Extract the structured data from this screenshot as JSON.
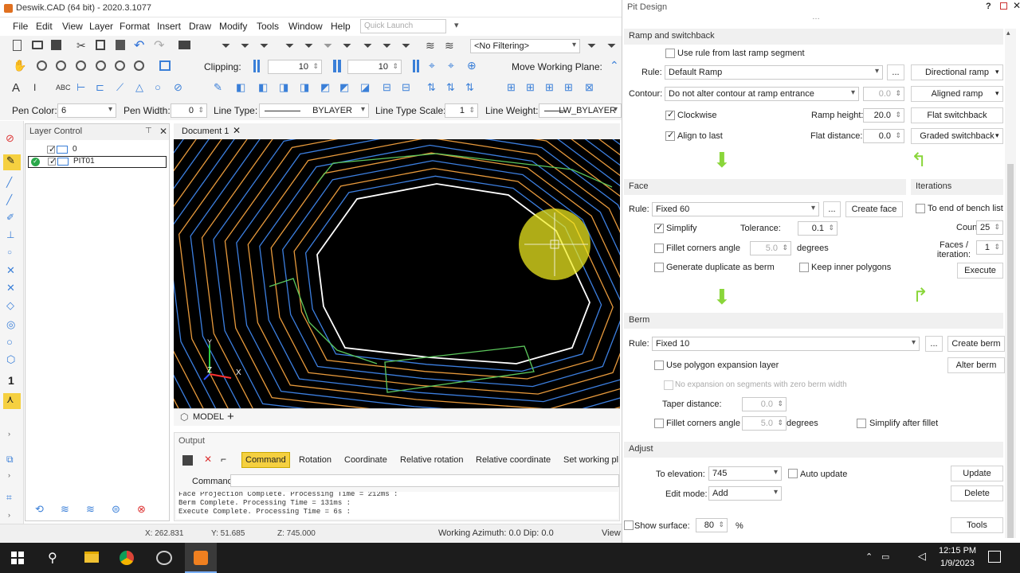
{
  "app": {
    "title": "Deswik.CAD (64 bit) - 2020.3.1077",
    "quick_launch_placeholder": "Quick Launch"
  },
  "menu": [
    "File",
    "Edit",
    "View",
    "Layer",
    "Format",
    "Draw",
    "Modify",
    "Tools",
    "Window",
    "Help"
  ],
  "toolbar": {
    "filter_label": "<No Filtering>",
    "clipping_label": "Clipping:",
    "clip_value_1": "10",
    "clip_value_2": "10",
    "move_plane_label": "Move Working Plane:"
  },
  "props": {
    "pen_color_label": "Pen Color:",
    "pen_color_value": "6",
    "pen_width_label": "Pen Width:",
    "pen_width_value": "0",
    "line_type_label": "Line Type:",
    "line_type_value": "BYLAYER",
    "line_type_scale_label": "Line Type Scale:",
    "line_type_scale_value": "1",
    "line_weight_label": "Line Weight:",
    "line_weight_value": "LW_BYLAYER"
  },
  "layer_panel": {
    "title": "Layer Control",
    "layers": [
      "0",
      "PIT01"
    ]
  },
  "document": {
    "tab": "Document 1",
    "model_tab": "MODEL"
  },
  "output": {
    "title": "Output",
    "tabs": [
      "Command",
      "Rotation",
      "Coordinate",
      "Relative rotation",
      "Relative coordinate",
      "Set working pl"
    ],
    "command_label": "Command:",
    "log": [
      "Face Projection Complete. Processing Time = 212ms :",
      "Berm Complete. Processing Time = 131ms :",
      "Execute Complete. Processing Time = 6s :"
    ]
  },
  "status": {
    "x": "X: 262.831",
    "y": "Y: 51.685",
    "z": "Z: 745.000",
    "azimuth": "Working Azimuth: 0.0 Dip: 0.0",
    "view": "View"
  },
  "pit": {
    "title": "Pit Design",
    "ramp": {
      "section": "Ramp and switchback",
      "use_rule": "Use rule from last ramp segment",
      "rule_label": "Rule:",
      "rule_value": "Default Ramp",
      "contour_label": "Contour:",
      "contour_value": "Do not alter contour at ramp entrance",
      "contour_num": "0.0",
      "clockwise": "Clockwise",
      "align_last": "Align to last",
      "ramp_height_label": "Ramp height:",
      "ramp_height": "20.0",
      "flat_distance_label": "Flat distance:",
      "flat_distance": "0.0",
      "directional": "Directional ramp",
      "aligned": "Aligned ramp",
      "flat_switchback": "Flat switchback",
      "graded_switchback": "Graded switchback",
      "dots": "..."
    },
    "face": {
      "section": "Face",
      "rule_label": "Rule:",
      "rule_value": "Fixed 60",
      "create": "Create face",
      "simplify": "Simplify",
      "tolerance_label": "Tolerance:",
      "tolerance": "0.1",
      "fillet": "Fillet corners angle",
      "fillet_value": "5.0",
      "degrees": "degrees",
      "duplicate": "Generate duplicate as berm",
      "keep_inner": "Keep inner polygons"
    },
    "iterations": {
      "section": "Iterations",
      "to_end": "To end of bench list",
      "count_label": "Count:",
      "count": "25",
      "faces_label": "Faces / iteration:",
      "faces": "1",
      "execute": "Execute"
    },
    "berm": {
      "section": "Berm",
      "rule_label": "Rule:",
      "rule_value": "Fixed 10",
      "create": "Create berm",
      "use_poly": "Use polygon expansion layer",
      "alter": "Alter berm",
      "no_expansion": "No expansion on segments with zero berm width",
      "taper_label": "Taper distance:",
      "taper": "0.0",
      "fillet": "Fillet corners angle",
      "fillet_value": "5.0",
      "degrees": "degrees",
      "simplify_after": "Simplify after fillet"
    },
    "adjust": {
      "section": "Adjust",
      "elev_label": "To elevation:",
      "elev": "745",
      "auto_update": "Auto update",
      "update": "Update",
      "edit_label": "Edit mode:",
      "edit": "Add",
      "delete": "Delete"
    },
    "show_surface": "Show surface:",
    "show_value": "80",
    "percent": "%",
    "tools": "Tools"
  },
  "clock": {
    "time": "12:15 PM",
    "date": "1/9/2023"
  },
  "colors": {
    "orange": "#e89a3c",
    "blue": "#3c7fe0",
    "green": "#5cc85c",
    "white": "#ffffff",
    "arrow_green": "#8ad63a"
  }
}
